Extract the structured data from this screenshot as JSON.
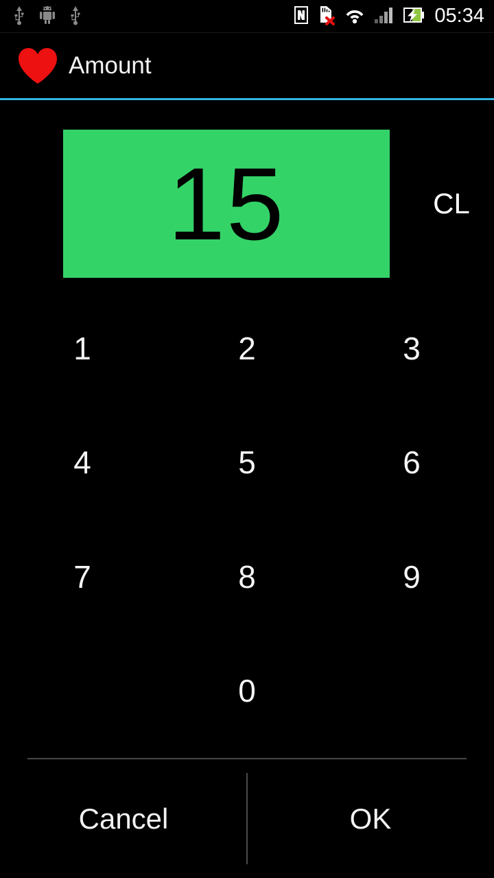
{
  "status_bar": {
    "left_icons": [
      {
        "name": "usb-icon",
        "label": "USB"
      },
      {
        "name": "android-icon",
        "label": "Android"
      },
      {
        "name": "usb-icon-2",
        "label": "USB"
      }
    ],
    "right_icons": [
      {
        "name": "nfc-icon",
        "label": "NFC"
      },
      {
        "name": "sd-card-removed-icon",
        "label": "SD card removed"
      },
      {
        "name": "wifi-icon",
        "label": "Wi-Fi"
      },
      {
        "name": "signal-icon",
        "label": "Cellular signal"
      },
      {
        "name": "battery-charging-icon",
        "label": "Battery charging"
      }
    ],
    "clock": "05:34"
  },
  "title_bar": {
    "icon": "heart-icon",
    "icon_color": "#ee1111",
    "title": "Amount",
    "accent_color": "#33b5e5"
  },
  "display": {
    "value": "15",
    "background_color": "#34d368",
    "text_color": "#000000",
    "clear_label": "CL"
  },
  "keypad": {
    "keys": [
      {
        "label": "1",
        "blank": false
      },
      {
        "label": "2",
        "blank": false
      },
      {
        "label": "3",
        "blank": false
      },
      {
        "label": "4",
        "blank": false
      },
      {
        "label": "5",
        "blank": false
      },
      {
        "label": "6",
        "blank": false
      },
      {
        "label": "7",
        "blank": false
      },
      {
        "label": "8",
        "blank": false
      },
      {
        "label": "9",
        "blank": false
      },
      {
        "label": "",
        "blank": true
      },
      {
        "label": "0",
        "blank": false
      },
      {
        "label": "",
        "blank": true
      }
    ]
  },
  "buttons": {
    "cancel_label": "Cancel",
    "ok_label": "OK"
  }
}
